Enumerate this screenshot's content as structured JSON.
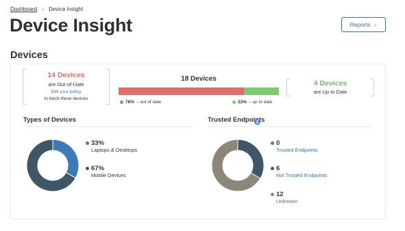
{
  "breadcrumb": {
    "home": "Dashboard",
    "separator": "›",
    "current": "Device Insight"
  },
  "page": {
    "title": "Device Insight"
  },
  "header": {
    "reports_label": "Reports",
    "reports_chevron": "⌄"
  },
  "devices": {
    "section_title": "Devices",
    "out_of_date": {
      "count_label": "14 Devices",
      "line1": "are Out-of-Date",
      "link": "Edit your policy",
      "line2": "to block these devices"
    },
    "total": {
      "label": "18 Devices",
      "out_of_date_fraction": 0.78,
      "up_to_date_fraction": 0.22
    },
    "legend": {
      "out_pct": "78%",
      "out_label": "– out of date",
      "up_pct": "22%",
      "up_label": "– up to date"
    },
    "up_to_date": {
      "count_label": "4 Devices",
      "line1": "are Up to Date"
    }
  },
  "types": {
    "title": "Types of Devices",
    "items": [
      {
        "pct": "33%",
        "label": "Laptops & Desktops",
        "value": 33,
        "color": "#3d7ab8"
      },
      {
        "pct": "67%",
        "label": "Mobile Devices",
        "value": 67,
        "color": "#3f5568"
      }
    ]
  },
  "trusted": {
    "title": "Trusted Endpoints",
    "info_icon": "i",
    "items": [
      {
        "count": "0",
        "label": "Trusted Endpoints",
        "value": 0,
        "color": "#3d7ab8"
      },
      {
        "count": "6",
        "label": "Not Trusted Endpoints",
        "value": 6,
        "color": "#3f5568"
      },
      {
        "count": "12",
        "label": "Unknown",
        "value": 12,
        "color": "#8c8778"
      }
    ]
  },
  "colors": {
    "red": "#e06c6c",
    "green": "#7ec96f",
    "link": "#3d6fa8",
    "text": "#2f3136"
  }
}
